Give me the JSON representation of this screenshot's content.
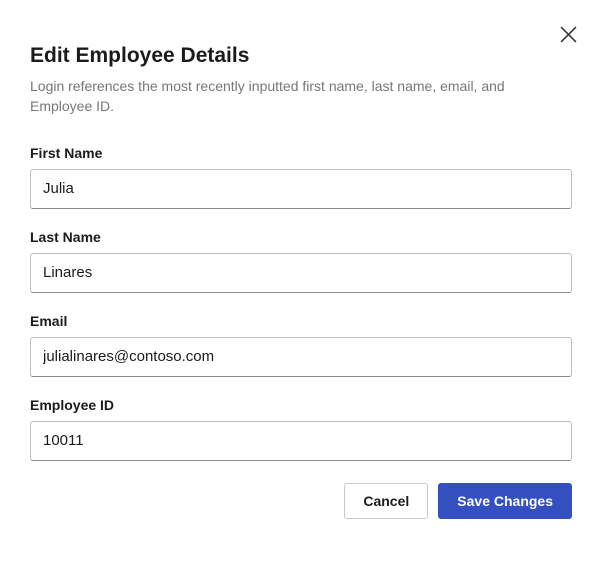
{
  "dialog": {
    "title": "Edit Employee Details",
    "subtitle": "Login references the most recently inputted first name, last name, email, and Employee ID."
  },
  "fields": {
    "first_name": {
      "label": "First Name",
      "value": "Julia"
    },
    "last_name": {
      "label": "Last Name",
      "value": "Linares"
    },
    "email": {
      "label": "Email",
      "value": "julialinares@contoso.com"
    },
    "employee_id": {
      "label": "Employee ID",
      "value": "10011"
    }
  },
  "buttons": {
    "cancel": "Cancel",
    "save": "Save Changes"
  }
}
